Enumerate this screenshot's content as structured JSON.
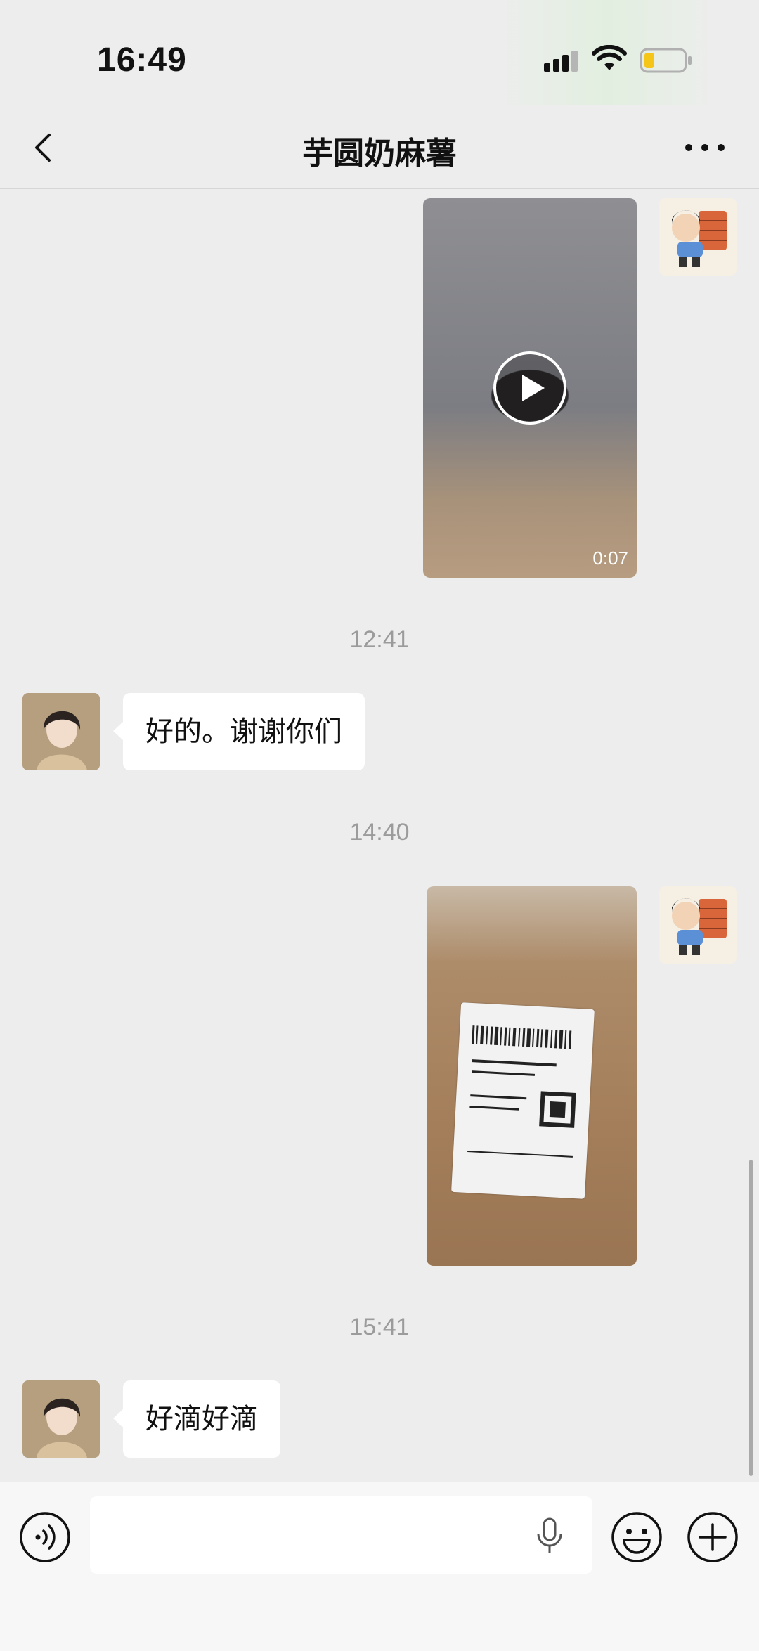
{
  "status_bar": {
    "time": "16:49"
  },
  "nav": {
    "title": "芋圆奶麻薯"
  },
  "messages": [
    {
      "type": "video",
      "sender": "self",
      "duration": "0:07"
    },
    {
      "type": "timestamp",
      "text": "12:41"
    },
    {
      "type": "text",
      "sender": "other",
      "text": "好的。谢谢你们"
    },
    {
      "type": "timestamp",
      "text": "14:40"
    },
    {
      "type": "image",
      "sender": "self"
    },
    {
      "type": "timestamp",
      "text": "15:41"
    },
    {
      "type": "text",
      "sender": "other",
      "text": "好滴好滴"
    }
  ],
  "input": {
    "placeholder": ""
  },
  "icons": {
    "back": "chevron-left-icon",
    "more": "ellipsis-icon",
    "voice": "voice-icon",
    "mic": "microphone-icon",
    "emoji": "smiley-icon",
    "plus": "plus-circle-icon"
  },
  "colors": {
    "background": "#ededed",
    "bubble": "#ffffff",
    "timestamp": "#9b9b9b",
    "battery_level": "#f5c518"
  }
}
